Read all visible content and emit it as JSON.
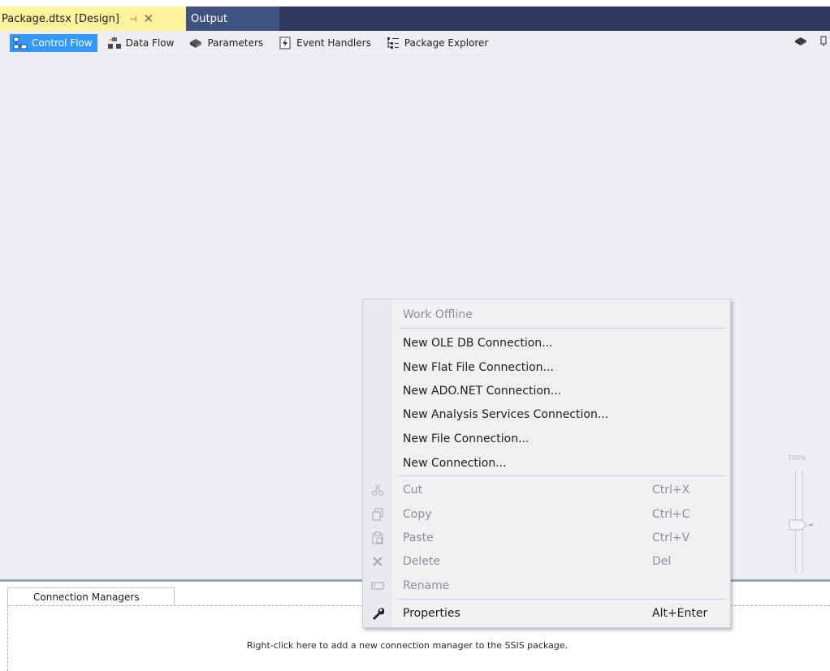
{
  "tabs": {
    "active_title": "Package.dtsx [Design]",
    "pin_glyph": "⊣",
    "close_glyph": "✕",
    "output_title": "Output"
  },
  "designer": {
    "tabs": [
      {
        "label": "Control Flow",
        "icon": "control-flow-icon"
      },
      {
        "label": "Data Flow",
        "icon": "data-flow-icon"
      },
      {
        "label": "Parameters",
        "icon": "parameters-icon"
      },
      {
        "label": "Event Handlers",
        "icon": "event-handlers-icon"
      },
      {
        "label": "Package Explorer",
        "icon": "package-explorer-icon"
      }
    ]
  },
  "zoom": {
    "level": "100%"
  },
  "context_menu": {
    "work_offline": "Work Offline",
    "new_oledb": "New OLE DB Connection...",
    "new_flat_file": "New Flat File Connection...",
    "new_adonet": "New ADO.NET Connection...",
    "new_analysis": "New Analysis Services Connection...",
    "new_file": "New File Connection...",
    "new_connection": "New Connection...",
    "cut": "Cut",
    "cut_key": "Ctrl+X",
    "copy": "Copy",
    "copy_key": "Ctrl+C",
    "paste": "Paste",
    "paste_key": "Ctrl+V",
    "delete": "Delete",
    "delete_key": "Del",
    "rename": "Rename",
    "properties": "Properties",
    "properties_key": "Alt+Enter"
  },
  "connection_managers": {
    "tab_label": "Connection Managers",
    "hint": "Right-click here to add a new connection manager to the SSIS package."
  },
  "colors": {
    "active_tab": "#fff29d",
    "tabbar": "#2d3a5e",
    "selected_designer_tab": "#3399ff"
  }
}
